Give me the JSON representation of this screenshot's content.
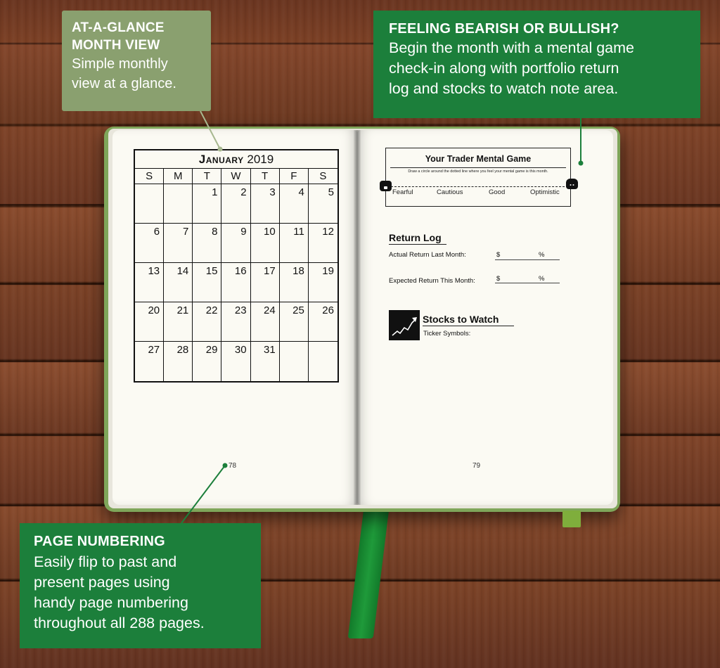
{
  "callouts": {
    "month_view": {
      "heading_line1": "AT-A-GLANCE",
      "heading_line2": "MONTH VIEW",
      "body_line1": "Simple monthly",
      "body_line2": "view at a glance."
    },
    "bearish_bullish": {
      "heading": "FEELING BEARISH OR BULLISH?",
      "body_line1": "Begin the month with a mental game",
      "body_line2": "check-in along with portfolio return",
      "body_line3": "log and stocks to watch note area."
    },
    "page_numbering": {
      "heading": "PAGE NUMBERING",
      "body_line1": "Easily flip to past and",
      "body_line2": "present pages using",
      "body_line3": "handy page numbering",
      "body_line4": "throughout all 288 pages."
    }
  },
  "calendar": {
    "month": "January",
    "year": "2019",
    "weekdays": [
      "S",
      "M",
      "T",
      "W",
      "T",
      "F",
      "S"
    ],
    "weeks": [
      [
        "",
        "",
        "1",
        "2",
        "3",
        "4",
        "5"
      ],
      [
        "6",
        "7",
        "8",
        "9",
        "10",
        "11",
        "12"
      ],
      [
        "13",
        "14",
        "15",
        "16",
        "17",
        "18",
        "19"
      ],
      [
        "20",
        "21",
        "22",
        "23",
        "24",
        "25",
        "26"
      ],
      [
        "27",
        "28",
        "29",
        "30",
        "31",
        "",
        ""
      ]
    ]
  },
  "pages": {
    "left_number": "78",
    "right_number": "79"
  },
  "mental_game": {
    "title": "Your Trader Mental Game",
    "instruction": "Draw a circle around the dotted line where you feel your mental game is this month.",
    "labels": [
      "Fearful",
      "Cautious",
      "Good",
      "Optimistic"
    ]
  },
  "return_log": {
    "title": "Return Log",
    "actual_label": "Actual Return Last Month:",
    "expected_label": "Expected Return This Month:",
    "currency": "$",
    "percent": "%"
  },
  "stocks": {
    "title": "Stocks to Watch",
    "ticker_label": "Ticker Symbols:"
  },
  "colors": {
    "callout_green": "#1c7f3b",
    "callout_gray": "#8aa06f",
    "cover_green": "#7fa65a",
    "ribbon_green": "#1f9a3a",
    "page": "#fbfaf3"
  },
  "icons": {
    "bear": "bear-icon",
    "bull": "bull-icon",
    "stock_chart": "stock-chart-icon"
  }
}
